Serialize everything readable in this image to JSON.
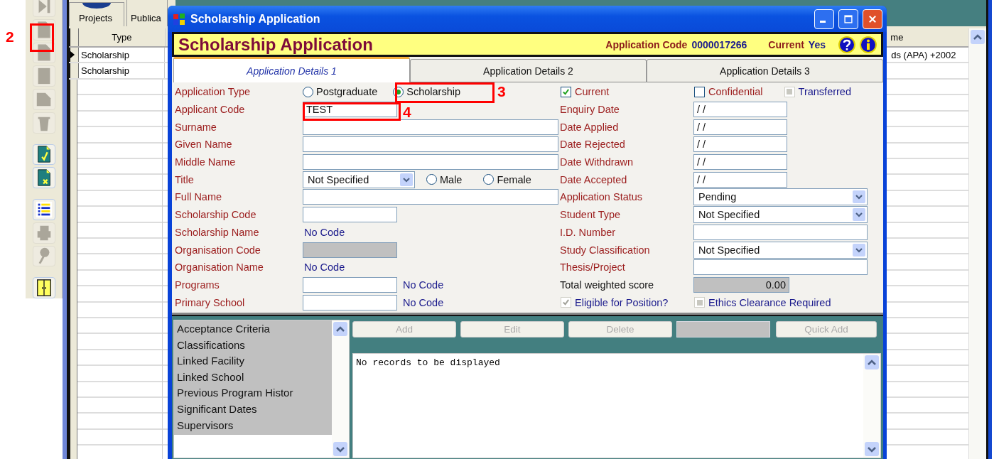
{
  "toolbar": [
    {
      "kind": "last",
      "disabled": true
    },
    {
      "kind": "new",
      "disabled": true
    },
    {
      "kind": "copy",
      "disabled": true
    },
    {
      "kind": "page",
      "disabled": true
    },
    {
      "kind": "fold",
      "disabled": true
    },
    {
      "kind": "delete",
      "disabled": true
    },
    {
      "kind": "save",
      "disabled": false
    },
    {
      "kind": "cancel",
      "disabled": false
    },
    {
      "kind": "list",
      "disabled": false
    },
    {
      "kind": "print",
      "disabled": true
    },
    {
      "kind": "search",
      "disabled": true
    },
    {
      "kind": "exit",
      "disabled": false
    }
  ],
  "background_tabs": [
    {
      "label": "Projects"
    },
    {
      "label": "Publica"
    }
  ],
  "table": {
    "columns": {
      "type": "Type",
      "column_3": "me"
    },
    "rows": [
      {
        "type": "Scholarship",
        "column_3": "ds (APA) +2002",
        "selected": true
      },
      {
        "type": "Scholarship",
        "selected": false
      }
    ]
  },
  "window": {
    "title": "Scholarship Application"
  },
  "header": {
    "title": "Scholarship Application",
    "code_label": "Application Code",
    "code": "0000017266",
    "current_label": "Current",
    "current": "Yes"
  },
  "tabs": [
    {
      "label": "Application Details 1",
      "selected": true
    },
    {
      "label": "Application Details 2",
      "selected": false
    },
    {
      "label": "Application Details 3",
      "selected": false
    }
  ],
  "form": {
    "left": [
      {
        "label": "Application Type",
        "kind": "radios",
        "options": [
          {
            "label": "Postgraduate",
            "selected": false
          },
          {
            "label": "Scholarship",
            "selected": true
          }
        ]
      },
      {
        "label": "Applicant Code",
        "kind": "short_field",
        "value": "TEST"
      },
      {
        "label": "Surname",
        "kind": "wide_field"
      },
      {
        "label": "Given Name",
        "kind": "wide_field"
      },
      {
        "label": "Middle Name",
        "kind": "wide_field"
      },
      {
        "label": "Title",
        "kind": "select_radios",
        "value": "Not Specified",
        "options": [
          {
            "label": "Male",
            "selected": false
          },
          {
            "label": "Female",
            "selected": false
          }
        ]
      },
      {
        "label": "Full Name",
        "kind": "wide_field"
      },
      {
        "label": "Scholarship Code",
        "kind": "short_field"
      },
      {
        "label": "Scholarship Name",
        "kind": "note",
        "note": "No Code"
      },
      {
        "label": "Organisation Code",
        "kind": "disabled_field"
      },
      {
        "label": "Organisation Name",
        "kind": "note",
        "note": "No Code"
      },
      {
        "label": "Programs",
        "kind": "field_note",
        "note": "No Code"
      },
      {
        "label": "Primary School",
        "kind": "field_note",
        "note": "No Code"
      }
    ],
    "right": [
      {
        "kind": "checks",
        "options": [
          {
            "label": "Current",
            "checked": true,
            "disabled": false
          },
          {
            "label": "Confidential",
            "checked": false,
            "disabled": false
          },
          {
            "label": "Transferred",
            "checked": false,
            "disabled": true
          }
        ]
      },
      {
        "label": "Enquiry Date",
        "kind": "date_field",
        "value": "/ /"
      },
      {
        "label": "Date Applied",
        "kind": "date_field",
        "value": "/ /"
      },
      {
        "label": "Date Rejected",
        "kind": "date_field",
        "value": "/ /"
      },
      {
        "label": "Date Withdrawn",
        "kind": "date_field",
        "value": "/ /"
      },
      {
        "label": "Date Accepted",
        "kind": "date_field",
        "value": "/ /"
      },
      {
        "label": "Application Status",
        "kind": "select",
        "value": "Pending"
      },
      {
        "label": "Student Type",
        "kind": "select",
        "value": "Not Specified"
      },
      {
        "label": "I.D. Number",
        "kind": "wide_field"
      },
      {
        "label": "Study Classification",
        "kind": "select",
        "value": "Not Specified"
      },
      {
        "label": "Thesis/Project",
        "kind": "wide_field"
      },
      {
        "label": "Total weighted score",
        "kind": "score",
        "value": "0.00"
      },
      {
        "kind": "checks",
        "options": [
          {
            "label": "Eligible for Position?",
            "checked": true,
            "disabled": true
          },
          {
            "label": "Ethics Clearance Required",
            "checked": false,
            "disabled": true
          }
        ]
      }
    ]
  },
  "sections": [
    {
      "label": "Acceptance Criteria"
    },
    {
      "label": "Classifications"
    },
    {
      "label": "Linked Facility"
    },
    {
      "label": "Linked School"
    },
    {
      "label": "Previous Program Histor"
    },
    {
      "label": "Significant Dates"
    },
    {
      "label": "Supervisors"
    }
  ],
  "actions": [
    {
      "kind": "button",
      "label": "Add",
      "disabled": true
    },
    {
      "kind": "button",
      "label": "Edit",
      "disabled": true
    },
    {
      "kind": "button",
      "label": "Delete",
      "disabled": true
    },
    {
      "kind": "field"
    },
    {
      "kind": "button",
      "label": "Quick Add",
      "disabled": true
    }
  ],
  "records": {
    "message": "No records to be displayed"
  },
  "annotations": [
    {
      "label": "2"
    },
    {
      "label": "3"
    },
    {
      "label": "4"
    }
  ]
}
